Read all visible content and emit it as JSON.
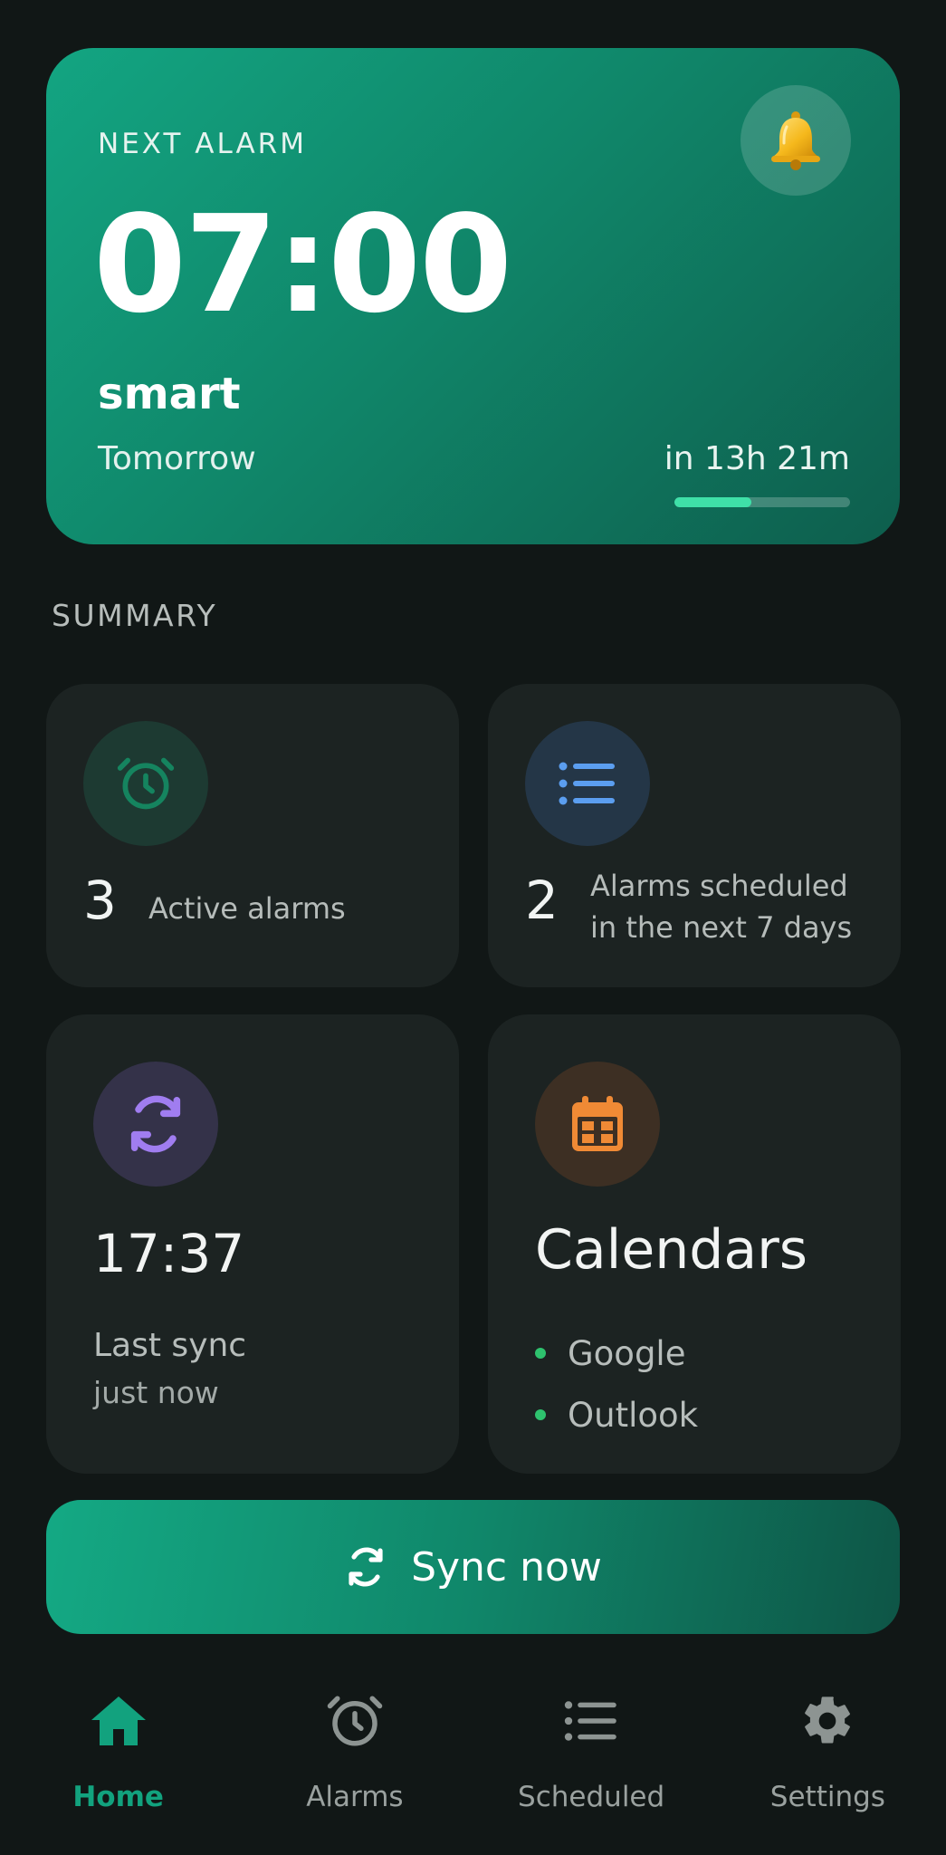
{
  "next_alarm": {
    "label": "NEXT ALARM",
    "time": "07:00",
    "name": "smart",
    "day": "Tomorrow",
    "countdown": "in 13h 21m",
    "progress_fraction": 0.44,
    "icon": "bell-icon"
  },
  "summary": {
    "title": "SUMMARY",
    "active_alarms": {
      "value": "3",
      "label": "Active alarms",
      "icon": "alarm-clock-icon"
    },
    "scheduled": {
      "value": "2",
      "label_line1": "Alarms scheduled",
      "label_line2": "in the next 7 days",
      "icon": "list-icon"
    },
    "sync": {
      "time": "17:37",
      "label": "Last sync",
      "sublabel": "just now",
      "icon": "sync-icon"
    },
    "calendars": {
      "title": "Calendars",
      "items": [
        "Google",
        "Outlook"
      ],
      "icon": "calendar-icon"
    }
  },
  "sync_button": {
    "label": "Sync now"
  },
  "nav": {
    "items": [
      {
        "label": "Home",
        "icon": "home-icon",
        "active": true
      },
      {
        "label": "Alarms",
        "icon": "alarm-clock-icon",
        "active": false
      },
      {
        "label": "Scheduled",
        "icon": "list-icon",
        "active": false
      },
      {
        "label": "Settings",
        "icon": "gear-icon",
        "active": false
      }
    ]
  },
  "colors": {
    "background": "#111716",
    "card": "#1c2322",
    "accent": "#12a27e",
    "progress": "#3fe0a8",
    "alarm_icon": "#15845f",
    "list_icon": "#5b9ef0",
    "sync_icon": "#a07df0",
    "calendar_icon": "#f08a35",
    "calendar_dot": "#2ec26e"
  }
}
